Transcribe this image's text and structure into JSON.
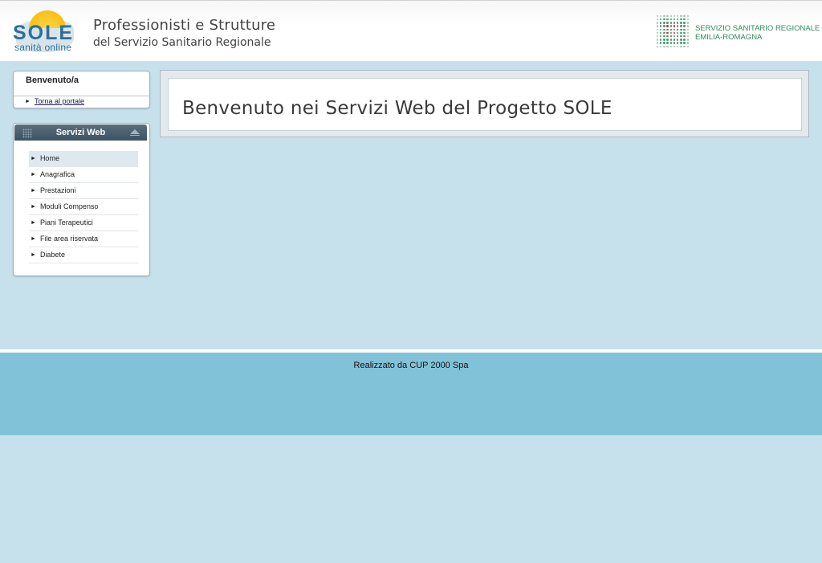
{
  "header": {
    "logo_text": "SOLE",
    "logo_sub": "sanità online",
    "title": "Professionisti e Strutture",
    "subtitle": "del Servizio Sanitario Regionale",
    "partner_line1": "SERVIZIO SANITARIO REGIONALE",
    "partner_line2": "EMILIA-ROMAGNA"
  },
  "welcome_box": {
    "title": "Benvenuto/a",
    "back_link": "Torna al portale"
  },
  "services": {
    "title": "Servizi Web",
    "items": [
      {
        "label": "Home",
        "active": true
      },
      {
        "label": "Anagrafica"
      },
      {
        "label": "Prestazioni"
      },
      {
        "label": "Moduli Compenso"
      },
      {
        "label": "Piani Terapeutici"
      },
      {
        "label": "File area riservata"
      },
      {
        "label": "Diabete"
      }
    ]
  },
  "main": {
    "heading": "Benvenuto nei Servizi Web del Progetto SOLE"
  },
  "footer": {
    "text": "Realizzato da CUP 2000 Spa"
  },
  "colors": {
    "background": "#c6e1ec",
    "footer": "#82c2d8",
    "panel_header": "#3d5262",
    "partner_green": "#2f8a5a"
  }
}
